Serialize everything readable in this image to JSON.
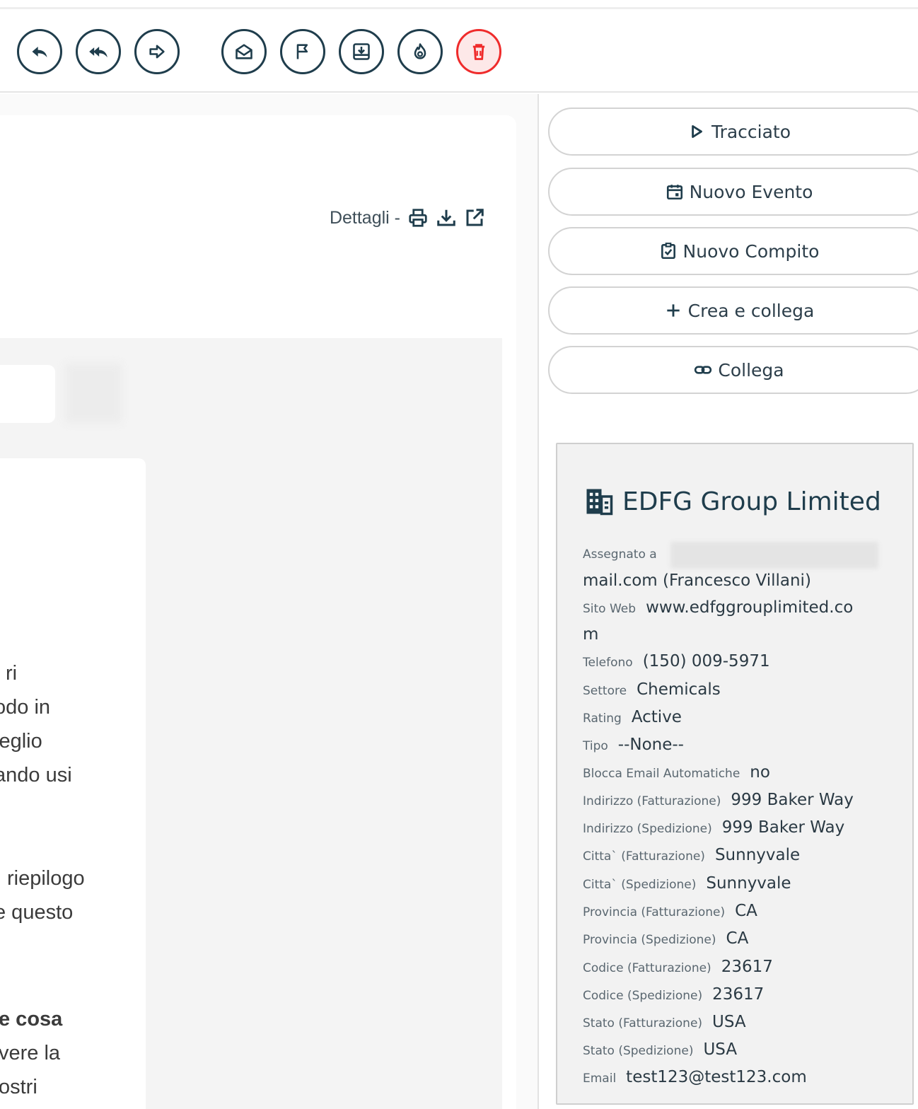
{
  "toolbar": {
    "buttons": [
      {
        "name": "reply-button",
        "icon": "reply-icon"
      },
      {
        "name": "reply-all-button",
        "icon": "reply-all-icon"
      },
      {
        "name": "forward-button",
        "icon": "forward-icon"
      },
      {
        "name": "mark-read-button",
        "icon": "envelope-open-icon"
      },
      {
        "name": "flag-button",
        "icon": "flag-icon"
      },
      {
        "name": "archive-button",
        "icon": "inbox-download-icon"
      },
      {
        "name": "spam-button",
        "icon": "fire-icon"
      },
      {
        "name": "delete-button",
        "icon": "trash-icon"
      }
    ],
    "danger_color": "#ef2b2b",
    "accent_color": "#1f3d4c"
  },
  "details": {
    "label": "Dettagli -",
    "icons": [
      "print-icon",
      "download-icon",
      "external-link-icon"
    ]
  },
  "message_fragments": [
    "ri",
    "odo in",
    "ieglio",
    "ando usi",
    "riepilogo",
    "e questo",
    "e cosa",
    "vere la",
    "ostri"
  ],
  "actions": {
    "tracciato": "Tracciato",
    "nuovo_evento": "Nuovo Evento",
    "nuovo_compito": "Nuovo Compito",
    "crea_collega": "Crea e collega",
    "collega": "Collega"
  },
  "company": {
    "name": "EDFG Group Limited",
    "icon": "building-icon",
    "assigned_label": "Assegnato a",
    "assigned_value": "mail.com (Francesco Villani)",
    "fields": [
      {
        "label": "Sito Web",
        "value": "www.edfggrouplimited.co"
      },
      {
        "label": "",
        "value": "m"
      },
      {
        "label": "Telefono",
        "value": "(150) 009-5971"
      },
      {
        "label": "Settore",
        "value": "Chemicals"
      },
      {
        "label": "Rating",
        "value": "Active"
      },
      {
        "label": "Tipo",
        "value": "--None--"
      },
      {
        "label": "Blocca Email Automatiche",
        "value": "no"
      },
      {
        "label": "Indirizzo (Fatturazione)",
        "value": "999 Baker Way"
      },
      {
        "label": "Indirizzo (Spedizione)",
        "value": "999 Baker Way"
      },
      {
        "label": "Citta` (Fatturazione)",
        "value": "Sunnyvale"
      },
      {
        "label": "Citta` (Spedizione)",
        "value": "Sunnyvale"
      },
      {
        "label": "Provincia (Fatturazione)",
        "value": "CA"
      },
      {
        "label": "Provincia (Spedizione)",
        "value": "CA"
      },
      {
        "label": "Codice (Fatturazione)",
        "value": "23617"
      },
      {
        "label": "Codice (Spedizione)",
        "value": "23617"
      },
      {
        "label": "Stato (Fatturazione)",
        "value": "USA"
      },
      {
        "label": "Stato (Spedizione)",
        "value": "USA"
      },
      {
        "label": "Email",
        "value": "test123@test123.com"
      }
    ]
  }
}
